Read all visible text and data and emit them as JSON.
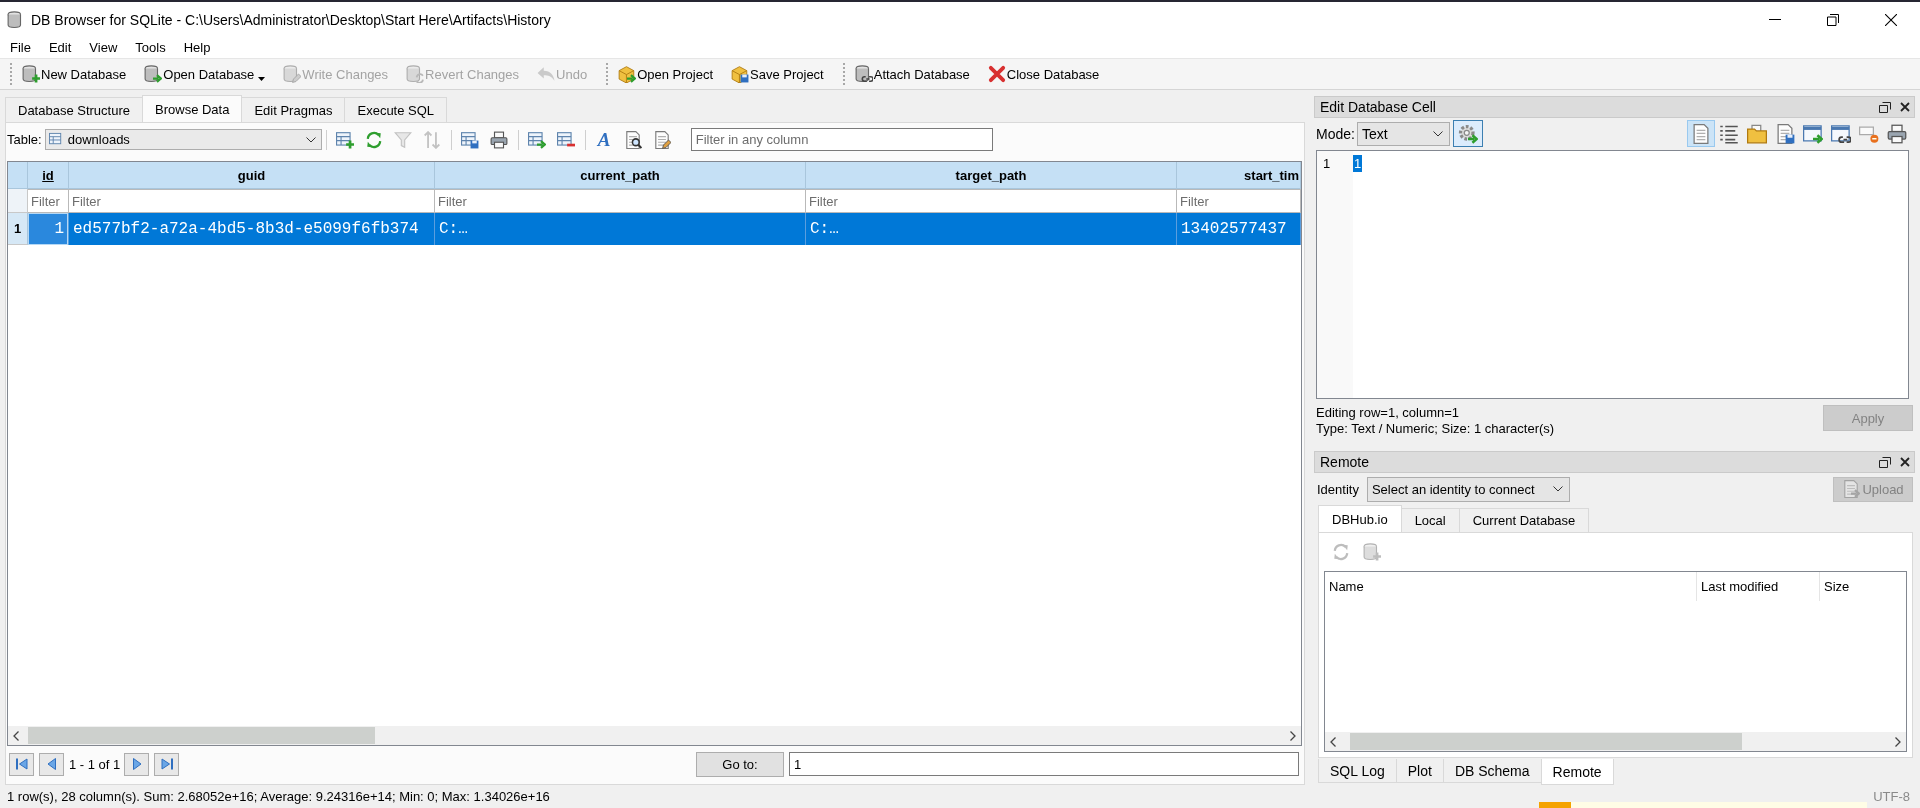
{
  "window": {
    "title": "DB Browser for SQLite - C:\\Users\\Administrator\\Desktop\\Start Here\\Artifacts\\History"
  },
  "menu": [
    "File",
    "Edit",
    "View",
    "Tools",
    "Help"
  ],
  "toolbar": {
    "groups": [
      {
        "buttons": [
          {
            "kind": "new-db",
            "label": "New Database",
            "disabled": false,
            "dropdown": false
          },
          {
            "kind": "open-db",
            "label": "Open Database",
            "disabled": false,
            "dropdown": true
          },
          {
            "kind": "write",
            "label": "Write Changes",
            "disabled": true,
            "dropdown": false
          },
          {
            "kind": "revert",
            "label": "Revert Changes",
            "disabled": true,
            "dropdown": false
          },
          {
            "kind": "undo",
            "label": "Undo",
            "disabled": true,
            "dropdown": false
          }
        ]
      },
      {
        "buttons": [
          {
            "kind": "open-project",
            "label": "Open Project",
            "disabled": false,
            "dropdown": false
          },
          {
            "kind": "save-project",
            "label": "Save Project",
            "disabled": false,
            "dropdown": false
          }
        ]
      },
      {
        "buttons": [
          {
            "kind": "attach",
            "label": "Attach Database",
            "disabled": false,
            "dropdown": false
          },
          {
            "kind": "close-db",
            "label": "Close Database",
            "disabled": false,
            "dropdown": false
          }
        ]
      }
    ]
  },
  "tabs": [
    {
      "label": "Database Structure",
      "selected": false
    },
    {
      "label": "Browse Data",
      "selected": true
    },
    {
      "label": "Edit Pragmas",
      "selected": false
    },
    {
      "label": "Execute SQL",
      "selected": false
    }
  ],
  "browse": {
    "table_label": "Table:",
    "table": "downloads",
    "tool_groups": [
      {
        "tools": [
          {
            "kind": "add-record",
            "disabled": false
          },
          {
            "kind": "refresh",
            "disabled": false
          },
          {
            "kind": "clear-filters",
            "disabled": true
          },
          {
            "kind": "clear-sort",
            "disabled": true
          }
        ]
      },
      {
        "tools": [
          {
            "kind": "save-table",
            "disabled": false
          },
          {
            "kind": "print",
            "disabled": false
          }
        ]
      },
      {
        "tools": [
          {
            "kind": "insert-values",
            "disabled": false
          },
          {
            "kind": "delete-record",
            "disabled": false
          }
        ]
      },
      {
        "tools": [
          {
            "kind": "font",
            "glyph": "A",
            "disabled": false
          },
          {
            "kind": "find",
            "disabled": false
          },
          {
            "kind": "cond-format",
            "disabled": false
          }
        ]
      }
    ],
    "filter": {
      "placeholder": "Filter in any column"
    },
    "grid": {
      "columns": [
        {
          "name": "id",
          "primary_key": true,
          "filter_placeholder": "Filter"
        },
        {
          "name": "guid",
          "primary_key": false,
          "filter_placeholder": "Filter"
        },
        {
          "name": "current_path",
          "primary_key": false,
          "filter_placeholder": "Filter"
        },
        {
          "name": "target_path",
          "primary_key": false,
          "filter_placeholder": "Filter"
        },
        {
          "name": "start_tim",
          "primary_key": false,
          "filter_placeholder": "Filter"
        }
      ],
      "rows": [
        {
          "number": "1",
          "selected": true,
          "cells": [
            {
              "text": "1",
              "focused": true
            },
            {
              "text": "ed577bf2-a72a-4bd5-8b3d-e5099f6fb374",
              "focused": false
            },
            {
              "text": "C:…",
              "focused": false
            },
            {
              "text": "C:…",
              "focused": false
            },
            {
              "text": "13402577437",
              "focused": false
            }
          ]
        }
      ]
    },
    "pager": {
      "range": "1 - 1 of 1",
      "goto": "Go to:",
      "value": "1"
    }
  },
  "cell_editor": {
    "title": "Edit Database Cell",
    "mode_label": "Mode:",
    "mode": "Text",
    "auto_switch": true,
    "tools": [
      {
        "kind": "auto-format",
        "selected": true
      },
      {
        "kind": "word-wrap",
        "selected": false
      },
      {
        "kind": "import",
        "selected": false
      },
      {
        "kind": "export",
        "selected": false
      },
      {
        "kind": "set-value",
        "selected": false
      },
      {
        "kind": "open-link",
        "selected": false
      },
      {
        "kind": "set-null",
        "selected": false
      },
      {
        "kind": "print-cell",
        "selected": false
      }
    ],
    "lines": [
      {
        "number": "1",
        "text": "1",
        "selected": true
      }
    ],
    "status": [
      "Editing row=1, column=1",
      "Type: Text / Numeric; Size: 1 character(s)"
    ],
    "apply": {
      "label": "Apply",
      "disabled": true
    }
  },
  "remote": {
    "title": "Remote",
    "identity_label": "Identity",
    "identity": "Select an identity to connect",
    "upload": {
      "label": "Upload",
      "disabled": true
    },
    "tabs": [
      {
        "label": "DBHub.io",
        "selected": true
      },
      {
        "label": "Local",
        "selected": false
      },
      {
        "label": "Current Database",
        "selected": false
      }
    ],
    "tools": [
      {
        "kind": "refresh",
        "disabled": true
      },
      {
        "kind": "clone",
        "disabled": true
      }
    ],
    "columns": [
      "Name",
      "Last modified",
      "Size"
    ]
  },
  "dock_tabs": [
    {
      "label": "SQL Log",
      "selected": false
    },
    {
      "label": "Plot",
      "selected": false
    },
    {
      "label": "DB Schema",
      "selected": false
    },
    {
      "label": "Remote",
      "selected": true
    }
  ],
  "status_bar": {
    "summary": "1 row(s), 28 column(s). Sum: 2.68052e+16; Average: 9.24316e+14; Min: 0; Max: 1.34026e+16",
    "encoding": "UTF-8"
  }
}
